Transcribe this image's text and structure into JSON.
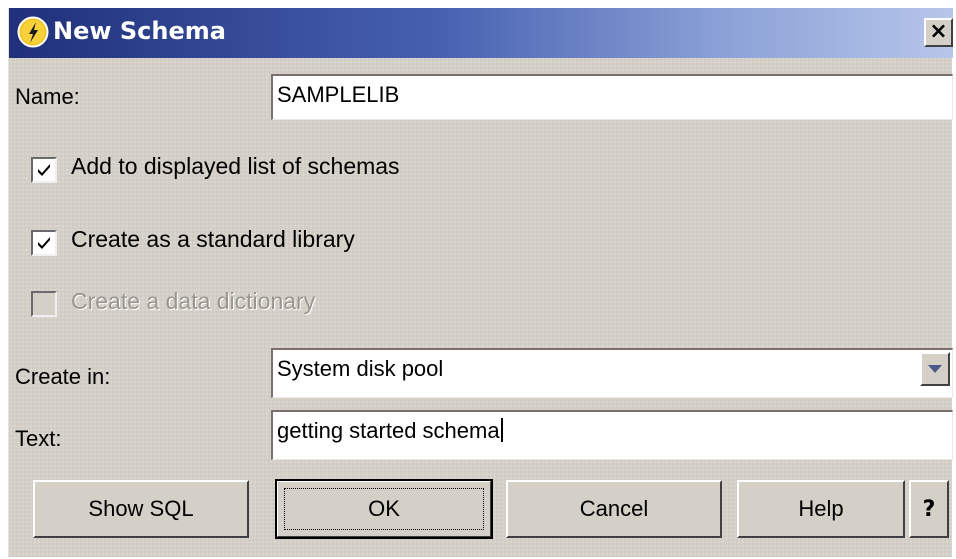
{
  "window": {
    "title": "New Schema",
    "close_label": "×"
  },
  "form": {
    "name_label": "Name:",
    "name_value": "SAMPLELIB",
    "checkboxes": [
      {
        "label": "Add to displayed list of schemas",
        "checked": true,
        "enabled": true
      },
      {
        "label": "Create as a standard library",
        "checked": true,
        "enabled": true
      },
      {
        "label": "Create a data dictionary",
        "checked": false,
        "enabled": false
      }
    ],
    "create_in_label": "Create in:",
    "create_in_value": "System disk pool",
    "text_label": "Text:",
    "text_value": "getting started schema"
  },
  "buttons": {
    "show_sql": "Show SQL",
    "ok": "OK",
    "cancel": "Cancel",
    "help": "Help",
    "whats_this": "?"
  },
  "icons": {
    "app": "db2-schema-icon",
    "close": "close-icon",
    "dropdown": "chevron-down-icon",
    "check": "check-icon"
  },
  "colors": {
    "title_gradient_start": "#20307a",
    "title_gradient_end": "#b7c6ea",
    "dialog_background": "#d4d0c8"
  }
}
